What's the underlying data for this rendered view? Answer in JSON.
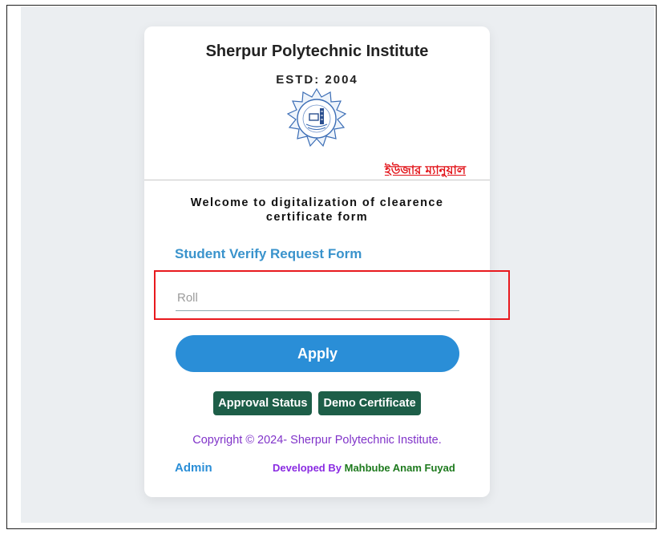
{
  "header": {
    "institute_name": "Sherpur Polytechnic Institute",
    "estd": "ESTD: 2004",
    "user_manual_link": "ইউজার ম্যানুয়াল"
  },
  "welcome": {
    "line1": "Welcome to digitalization of clearence",
    "line2": "certificate form"
  },
  "form": {
    "title": "Student Verify Request Form",
    "roll_placeholder": "Roll",
    "roll_value": "",
    "apply_label": "Apply"
  },
  "actions": {
    "approval_status_label": "Approval Status",
    "demo_certificate_label": "Demo Certificate"
  },
  "footer": {
    "copyright": "Copyright © 2024- Sherpur Polytechnic Institute.",
    "admin_label": "Admin",
    "developed_by_prefix": "Developed By",
    "developer_name": "Mahbube Anam Fuyad"
  },
  "colors": {
    "accent_blue": "#2a8ed7",
    "dark_green": "#1d5e48",
    "highlight_red": "#e8191e",
    "purple": "#8033c9"
  },
  "icons": {
    "logo": "institute-emblem-icon"
  }
}
